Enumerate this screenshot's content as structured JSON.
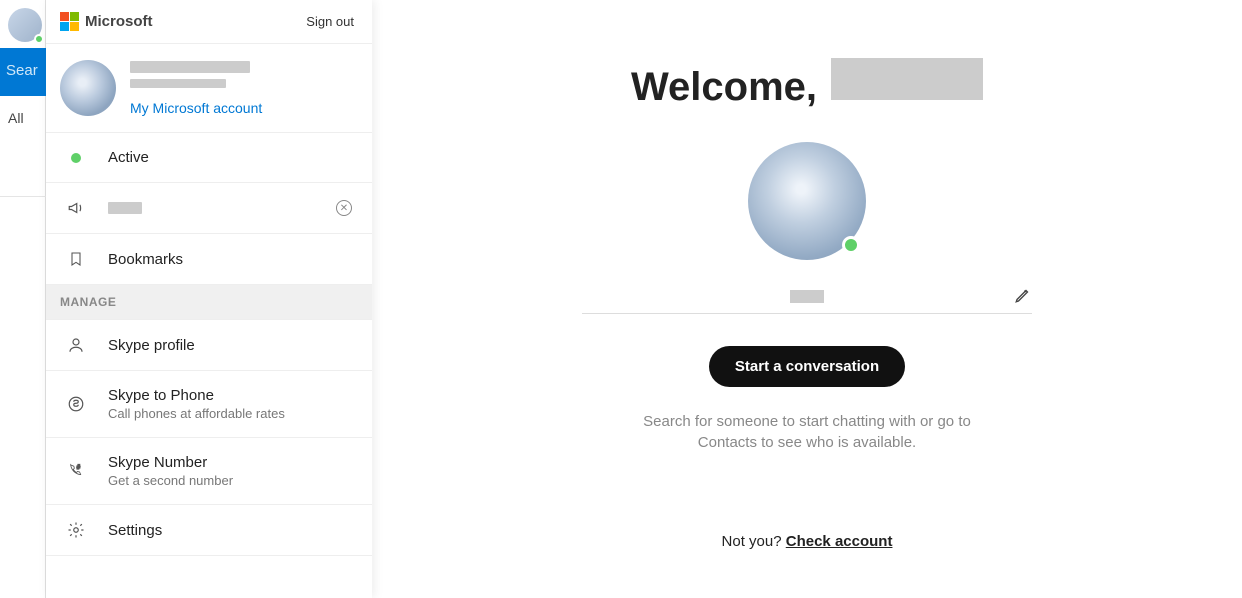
{
  "bg": {
    "search": "Sear",
    "all": "All"
  },
  "panel": {
    "brand": "Microsoft",
    "sign_out": "Sign out",
    "my_account": "My Microsoft account",
    "status_label": "Active",
    "bookmarks": "Bookmarks",
    "manage_label": "MANAGE",
    "skype_profile": "Skype profile",
    "skype_to_phone": {
      "title": "Skype to Phone",
      "desc": "Call phones at affordable rates"
    },
    "skype_number": {
      "title": "Skype Number",
      "desc": "Get a second number"
    },
    "settings": "Settings"
  },
  "main": {
    "welcome": "Welcome,",
    "start_button": "Start a conversation",
    "help_text": "Search for someone to start chatting with or go to Contacts to see who is available.",
    "not_you": "Not you? ",
    "check_account": "Check account"
  }
}
